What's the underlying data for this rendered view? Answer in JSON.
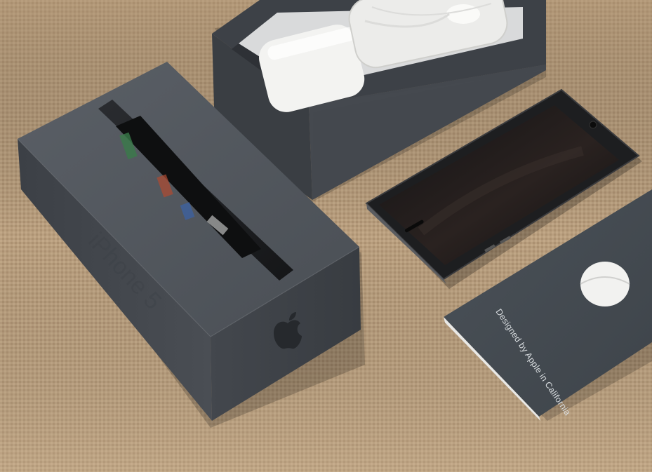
{
  "photo": {
    "subject": "iPhone 5 unboxing",
    "surface": "woven tan fabric",
    "box_lid_text": "iPhone 5",
    "booklet_text": "Designed by Apple in California",
    "logo": "apple-logo-icon"
  },
  "colors": {
    "fabric": "#b99f7f",
    "box": "#4b5056",
    "box_dark": "#3a3e43",
    "phone": "#1b1c1e",
    "accessories": "#f2f2f0"
  }
}
